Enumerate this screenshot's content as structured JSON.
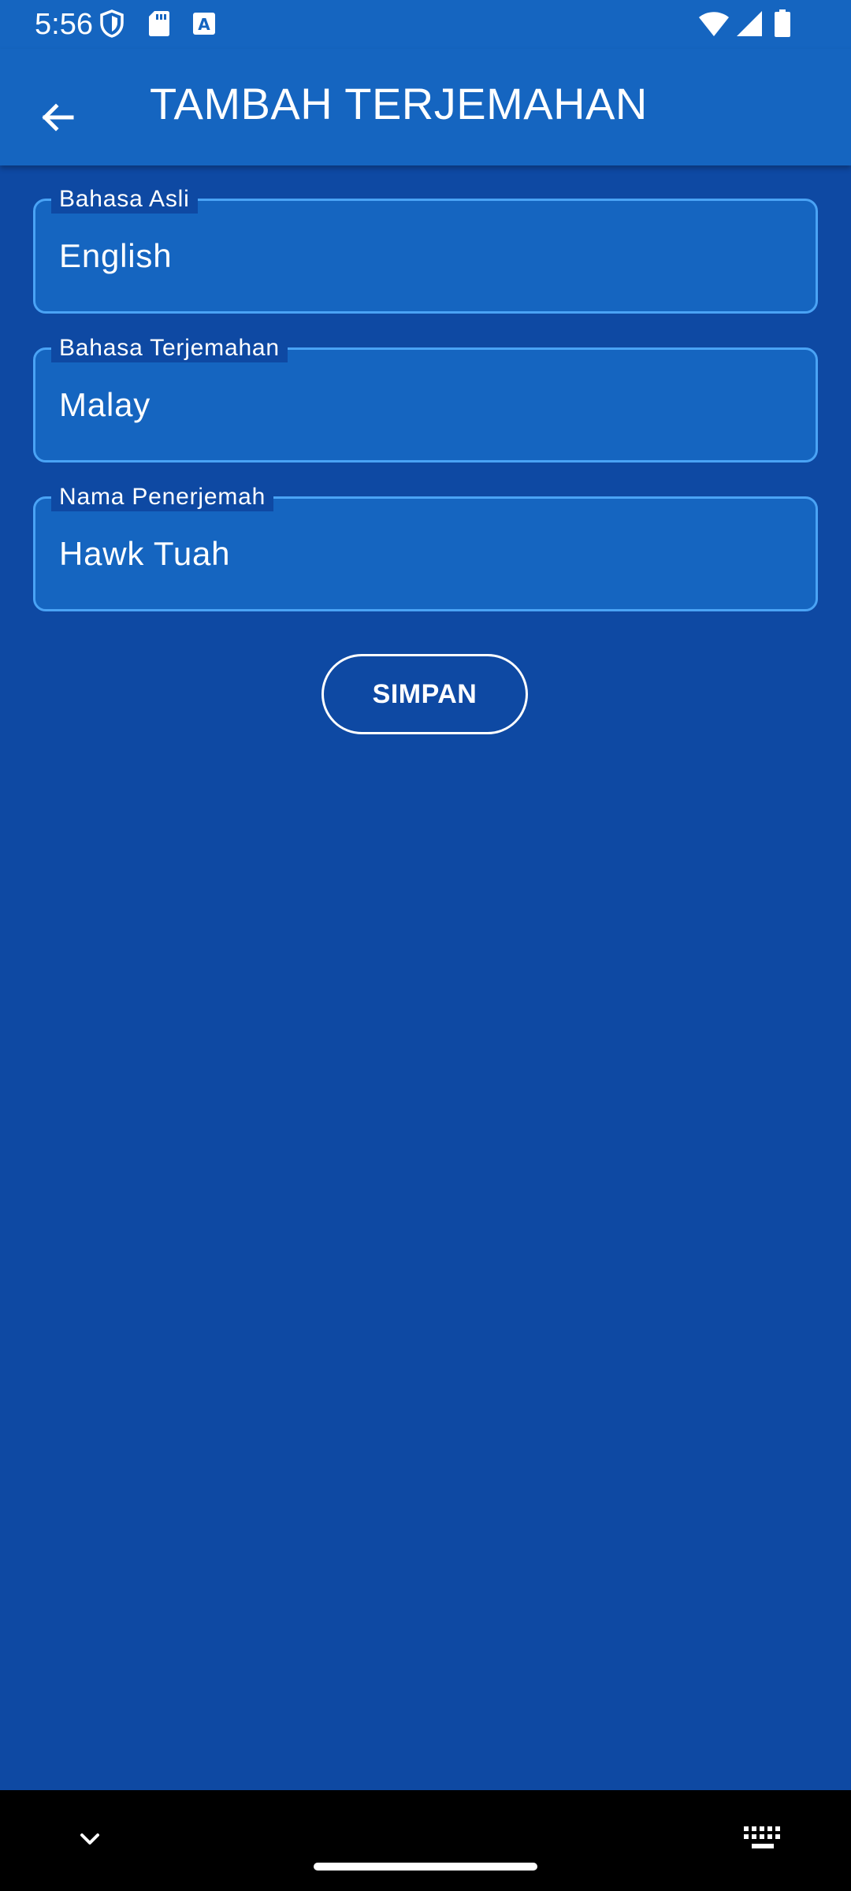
{
  "status_bar": {
    "time": "5:56",
    "icons": [
      "shield-icon",
      "sd-card-icon",
      "font-a-icon",
      "wifi-icon",
      "signal-icon",
      "battery-icon"
    ]
  },
  "app_bar": {
    "title": "TAMBAH TERJEMAHAN",
    "back_icon": "arrow-left-icon"
  },
  "form": {
    "fields": [
      {
        "label": "Bahasa Asli",
        "value": "English"
      },
      {
        "label": "Bahasa Terjemahan",
        "value": "Malay"
      },
      {
        "label": "Nama Penerjemah",
        "value": "Hawk Tuah"
      }
    ],
    "save_label": "SIMPAN"
  },
  "nav_bar": {
    "icons": [
      "chevron-down-icon",
      "keyboard-icon"
    ]
  },
  "colors": {
    "background": "#0e49a3",
    "app_bar": "#1565c0",
    "field_fill": "#1565c0",
    "field_border": "#4aa3f5",
    "text": "#ffffff",
    "nav_bar": "#000000"
  }
}
